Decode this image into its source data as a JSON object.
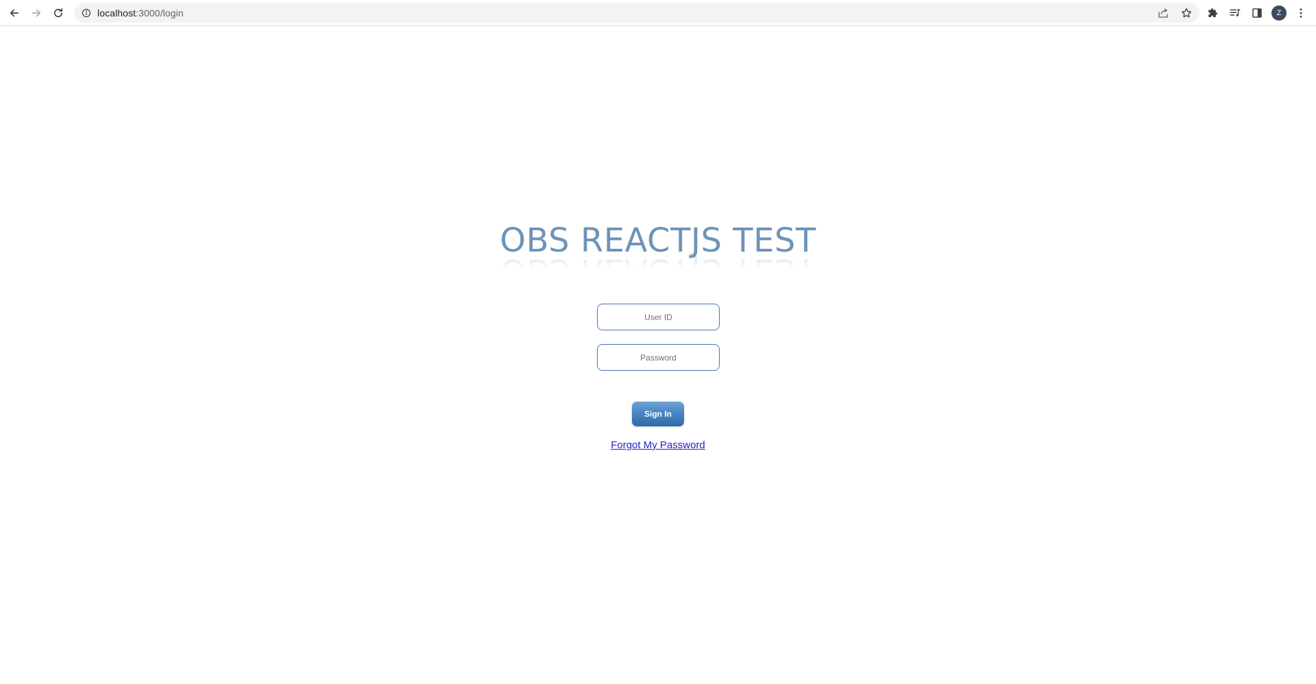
{
  "browser": {
    "url_host": "localhost",
    "url_rest": ":3000/login",
    "profile_initial": "Z"
  },
  "login": {
    "title": "OBS REACTJS TEST",
    "user_id_placeholder": "User ID",
    "password_placeholder": "Password",
    "sign_in_label": "Sign In",
    "forgot_link": "Forgot My Password"
  },
  "icons": {
    "back": "arrow-left-icon",
    "forward": "arrow-right-icon",
    "reload": "reload-icon",
    "site_info": "info-icon",
    "share": "share-icon",
    "bookmark": "star-icon",
    "extensions": "puzzle-icon",
    "media": "media-queue-icon",
    "side_panel": "side-panel-icon",
    "menu": "kebab-menu-icon"
  },
  "colors": {
    "title": "#6e93b9",
    "field_border": "#4a73b9",
    "button_top": "#6fa3d6",
    "button_bottom": "#2f6aaa",
    "link": "#2323c6"
  }
}
